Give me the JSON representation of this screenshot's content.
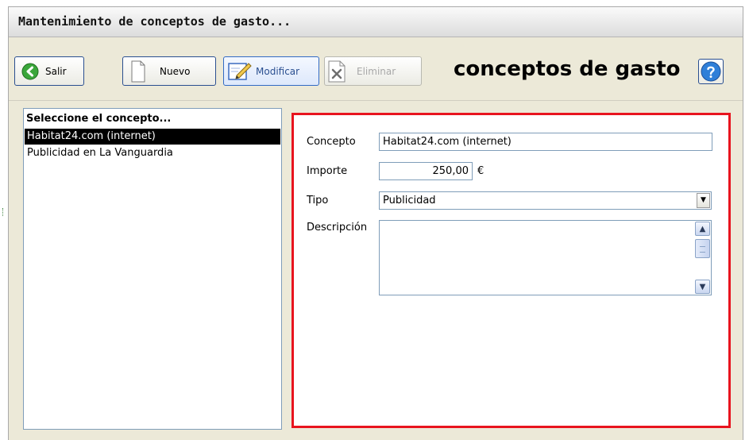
{
  "window": {
    "title": "Mantenimiento de conceptos de gasto..."
  },
  "toolbar": {
    "exit_label": "Salir",
    "new_label": "Nuevo",
    "edit_label": "Modificar",
    "delete_label": "Eliminar",
    "heading": "conceptos de gasto",
    "help_icon": "help-icon"
  },
  "concept_list": {
    "header": "Seleccione el concepto...",
    "items": [
      {
        "label": "Habitat24.com (internet)",
        "selected": true
      },
      {
        "label": "Publicidad en La Vanguardia",
        "selected": false
      }
    ]
  },
  "form": {
    "concept_label": "Concepto",
    "concept_value": "Habitat24.com (internet)",
    "amount_label": "Importe",
    "amount_value": "250,00",
    "currency": "€",
    "type_label": "Tipo",
    "type_value": "Publicidad",
    "description_label": "Descripción",
    "description_value": ""
  },
  "colors": {
    "highlight_border": "#e8141e",
    "selection_bg": "#000000",
    "window_bg": "#ece9d8"
  }
}
